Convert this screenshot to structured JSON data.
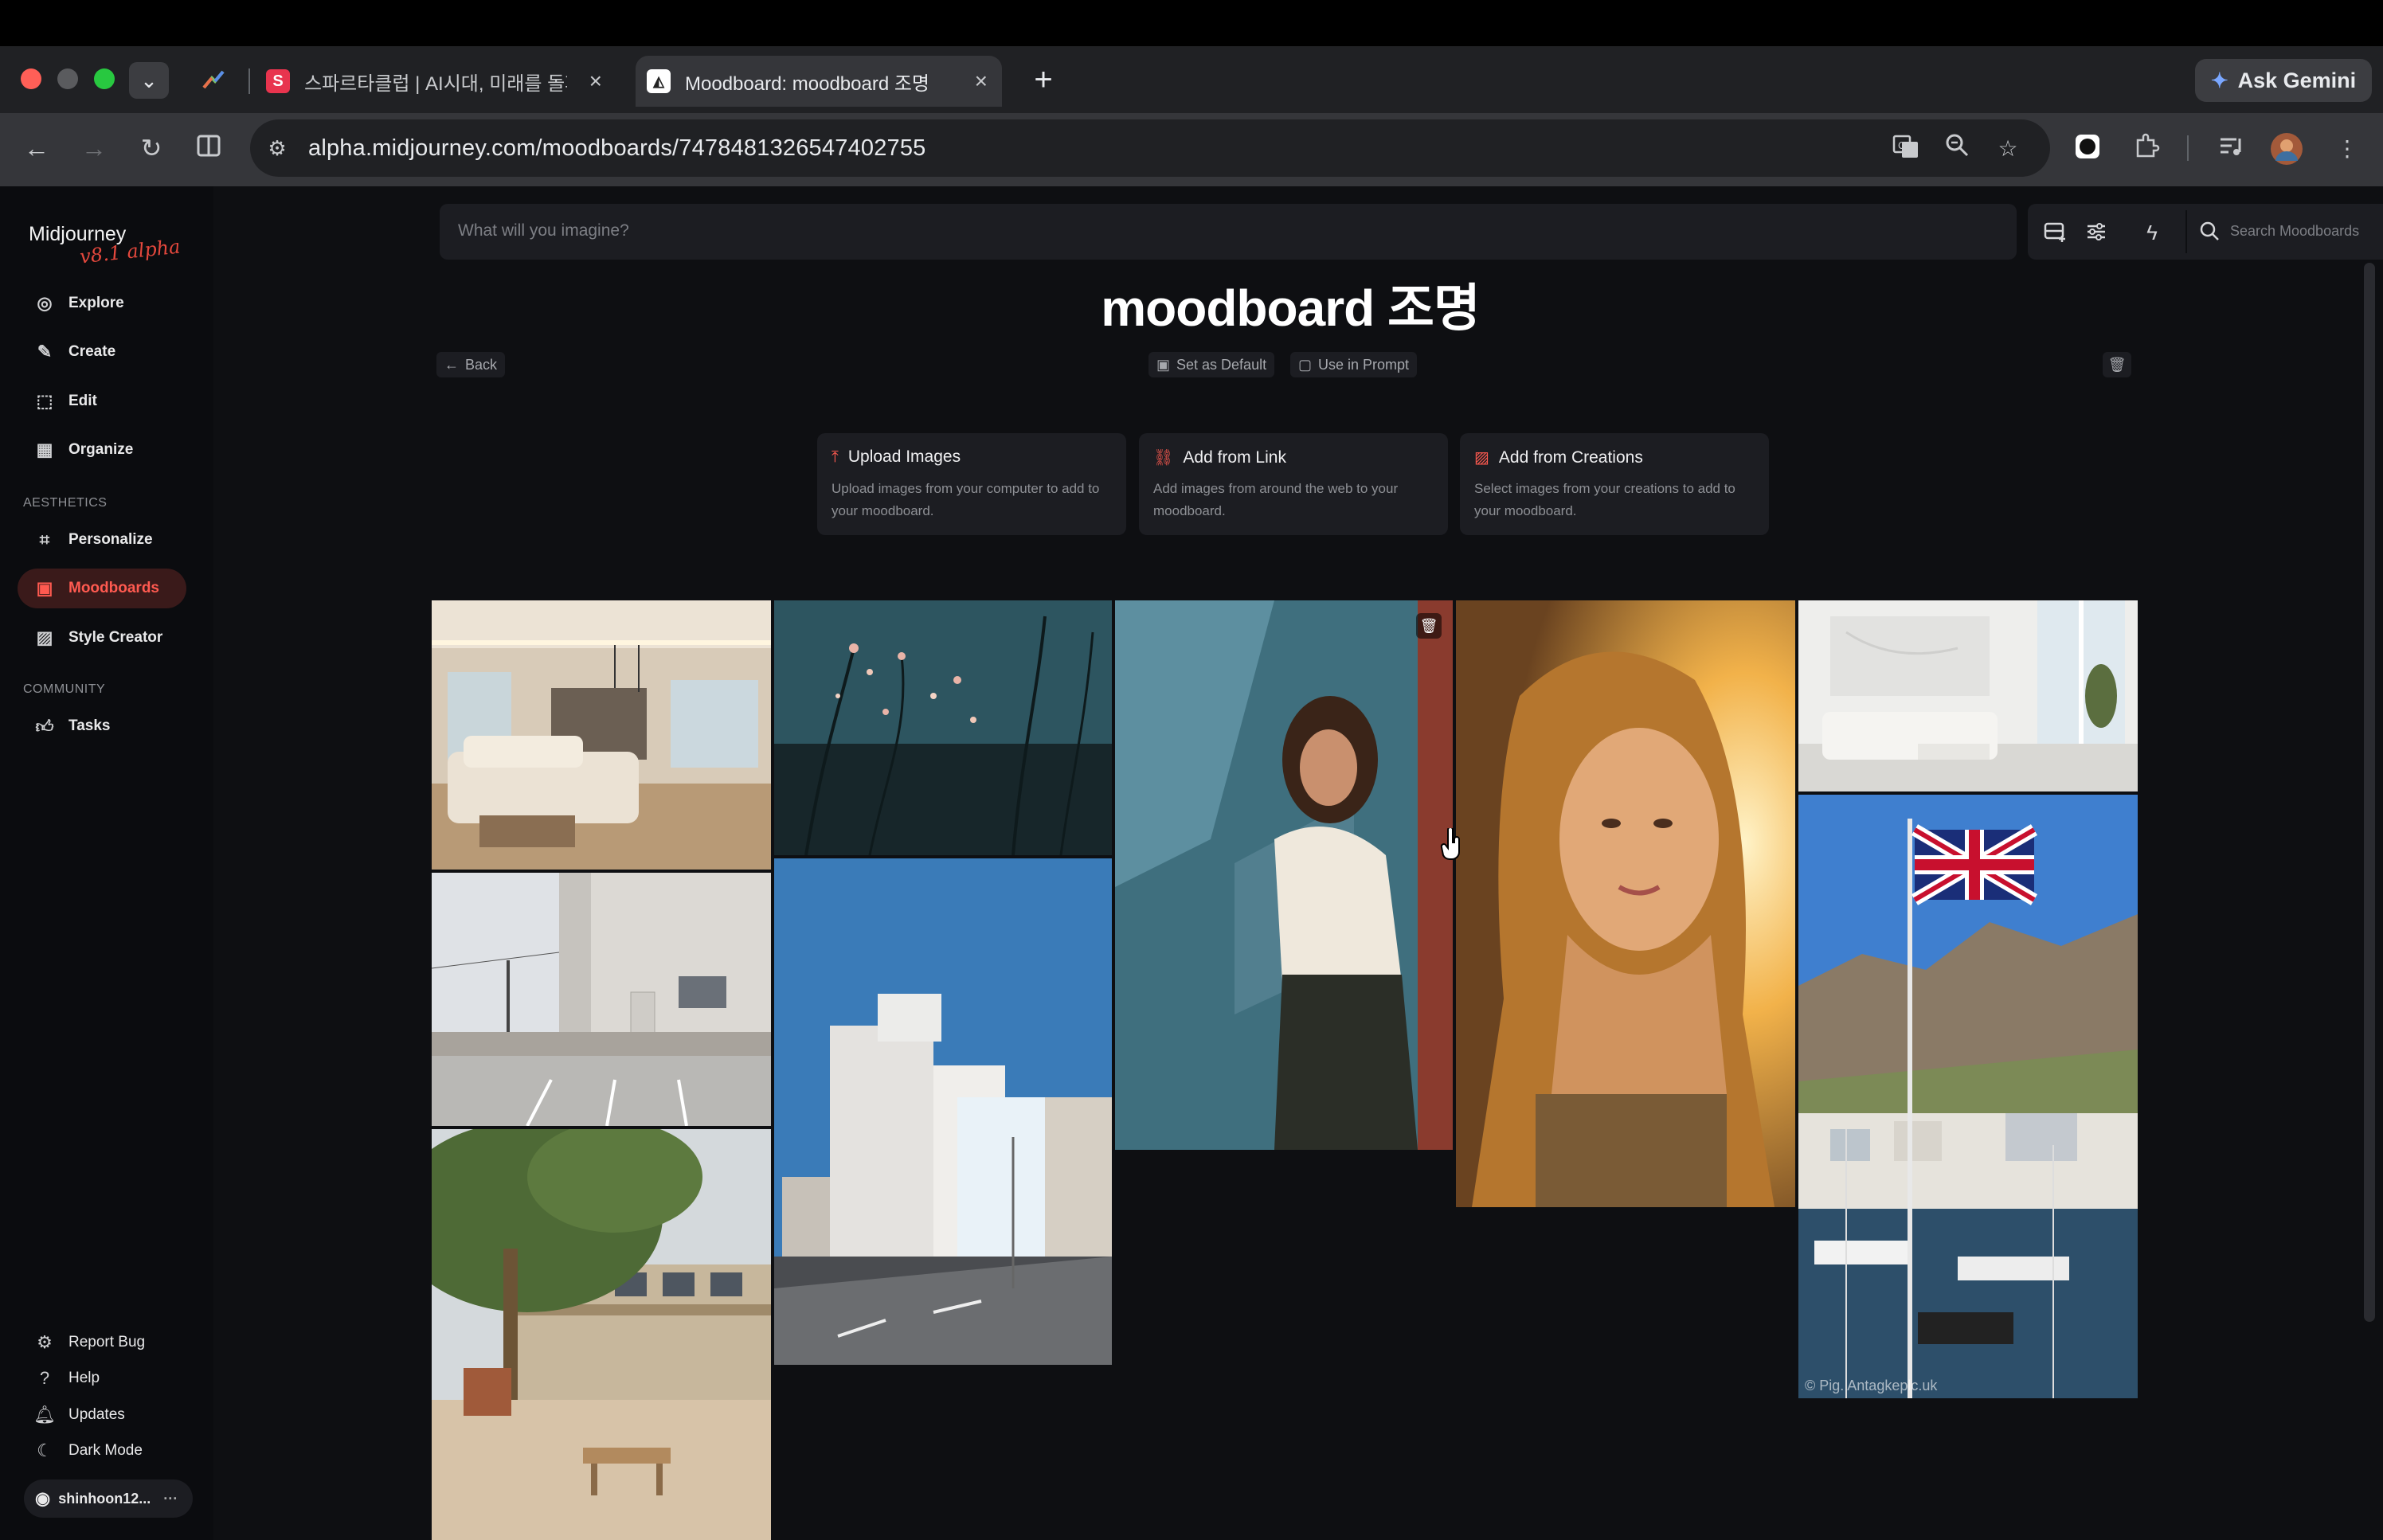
{
  "browser": {
    "tabs": [
      {
        "title": "스파르타클럽 | AI시대, 미래를 돌파",
        "favicon": "S",
        "favicon_color": "#e8344e"
      },
      {
        "title": "Moodboard: moodboard 조명",
        "favicon": "◭",
        "favicon_color": "#ffffff"
      }
    ],
    "ask_gemini": "Ask Gemini",
    "url_host": "alpha.midjourney.com",
    "url_path": "/moodboards/7478481326547402755"
  },
  "sidebar": {
    "logo": "Midjourney",
    "logo_sub": "v8.1 alpha",
    "nav_main": [
      {
        "label": "Explore",
        "icon": "compass-icon"
      },
      {
        "label": "Create",
        "icon": "brush-icon"
      },
      {
        "label": "Edit",
        "icon": "edit-icon"
      },
      {
        "label": "Organize",
        "icon": "grid-icon"
      }
    ],
    "aesthetics_heading": "AESTHETICS",
    "nav_aesthetics": [
      {
        "label": "Personalize",
        "icon": "personalize-icon"
      },
      {
        "label": "Moodboards",
        "icon": "moodboard-icon",
        "active": true
      },
      {
        "label": "Style Creator",
        "icon": "style-icon"
      }
    ],
    "community_heading": "COMMUNITY",
    "nav_community": [
      {
        "label": "Tasks",
        "icon": "thumbs-up-icon"
      }
    ],
    "nav_bottom": [
      {
        "label": "Report Bug",
        "icon": "bug-icon"
      },
      {
        "label": "Help",
        "icon": "help-icon"
      },
      {
        "label": "Updates",
        "icon": "bell-icon"
      },
      {
        "label": "Dark Mode",
        "icon": "moon-icon"
      }
    ],
    "user": "shinhoon12...",
    "accent_color": "#ff5a50"
  },
  "topbar": {
    "prompt_placeholder": "What will you imagine?",
    "search_placeholder": "Search Moodboards"
  },
  "main": {
    "title": "moodboard 조명",
    "back_label": "Back",
    "set_default_label": "Set as Default",
    "use_in_prompt_label": "Use in Prompt",
    "cards": [
      {
        "title": "Upload Images",
        "desc": "Upload images from your computer to add to your moodboard.",
        "icon": "upload-icon"
      },
      {
        "title": "Add from Link",
        "desc": "Add images from around the web to your moodboard.",
        "icon": "link-icon"
      },
      {
        "title": "Add from Creations",
        "desc": "Select images from your creations to add to your moodboard.",
        "icon": "creations-icon"
      }
    ],
    "images": [
      {
        "name": "living-room-image"
      },
      {
        "name": "flowers-image"
      },
      {
        "name": "woman-shadow-image"
      },
      {
        "name": "woman-portrait-image"
      },
      {
        "name": "white-interior-image"
      },
      {
        "name": "building-parking-image"
      },
      {
        "name": "city-street-image"
      },
      {
        "name": "harbor-flag-image"
      },
      {
        "name": "school-tree-image"
      }
    ],
    "image_credit": "© Pig. Antagkeplc.uk"
  }
}
